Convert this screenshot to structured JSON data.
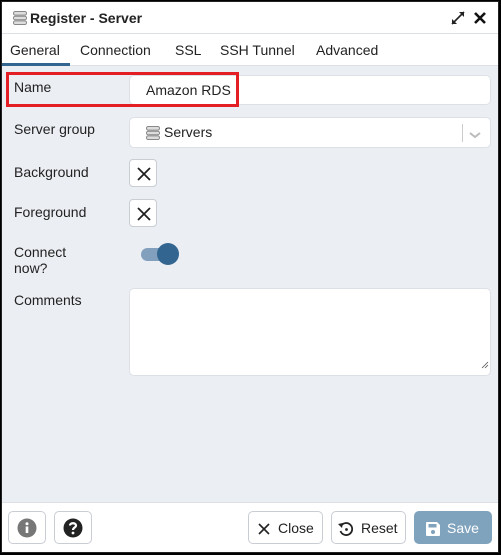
{
  "window": {
    "title": "Register - Server",
    "title_icon": "server-icon",
    "actions": [
      "expand-icon",
      "close-icon"
    ]
  },
  "tabs": [
    {
      "label": "General",
      "active": true
    },
    {
      "label": "Connection",
      "active": false
    },
    {
      "label": "SSL",
      "active": false
    },
    {
      "label": "SSH Tunnel",
      "active": false
    },
    {
      "label": "Advanced",
      "active": false
    }
  ],
  "form": {
    "name": {
      "label": "Name",
      "value": "Amazon RDS"
    },
    "server_group": {
      "label": "Server group",
      "value": "Servers",
      "icon": "server-group-icon"
    },
    "background": {
      "label": "Background",
      "value": "none",
      "icon": "x-icon"
    },
    "foreground": {
      "label": "Foreground",
      "value": "none",
      "icon": "x-icon"
    },
    "connect_now": {
      "label_line1": "Connect",
      "label_line2": "now?",
      "checked": true
    },
    "comments": {
      "label": "Comments",
      "value": ""
    }
  },
  "footer": {
    "info_icon": "info-icon",
    "help_icon": "help-icon",
    "close_label": "Close",
    "reset_label": "Reset",
    "save_label": "Save",
    "save_enabled": false
  },
  "colors": {
    "accent": "#326690",
    "highlight": "#e31e25",
    "save_disabled": "#7fa2bd",
    "panel_bg": "#ebeef3"
  }
}
